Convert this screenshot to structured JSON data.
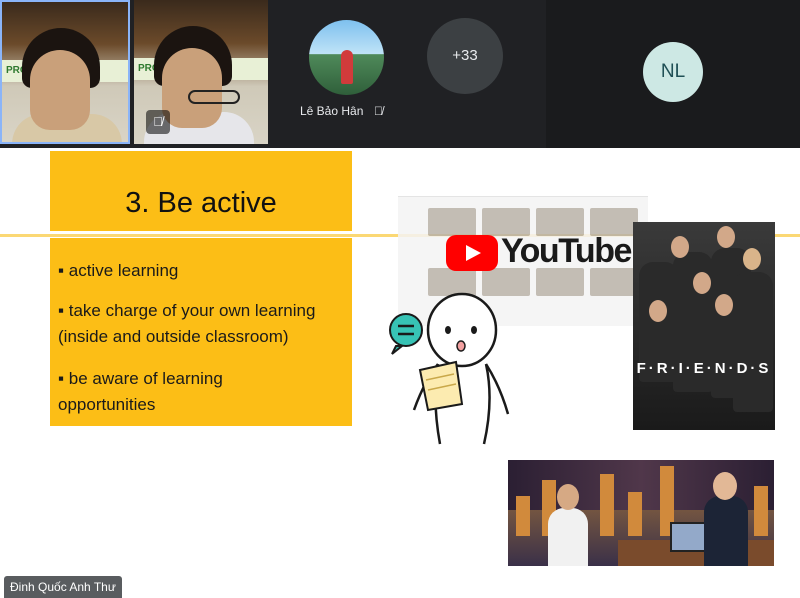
{
  "meeting": {
    "participants": [
      {
        "type": "camera",
        "name": "",
        "banner": "PROVING YOUR",
        "muted": false,
        "active_speaker": true
      },
      {
        "type": "camera",
        "name": "",
        "banner": "PROVING YOUR",
        "muted": true
      },
      {
        "type": "avatar-photo",
        "name": "Lê Bảo Hân",
        "muted": true
      },
      {
        "type": "overflow",
        "label": "+33"
      },
      {
        "type": "initials",
        "label": "NL"
      }
    ],
    "presenter_name": "Đinh Quốc Anh Thư"
  },
  "slide": {
    "title": "3. Be active",
    "bullets": [
      {
        "line1": "▪ active learning",
        "line2": ""
      },
      {
        "line1": "▪ take charge of your own learning",
        "line2": "(inside and outside classroom)"
      },
      {
        "line1": "▪ be aware of learning",
        "line2": "opportunities"
      }
    ],
    "youtube_wordmark": "YouTube",
    "friends_logo": "F·R·I·E·N·D·S",
    "colors": {
      "title_box": "#fcbe16",
      "accent_line": "#fbd874",
      "youtube_red": "#ff0000",
      "speech_bubble": "#37c3b5"
    }
  },
  "icons": [
    "mic-off-icon",
    "youtube-play-icon",
    "speech-bubble-icon"
  ]
}
